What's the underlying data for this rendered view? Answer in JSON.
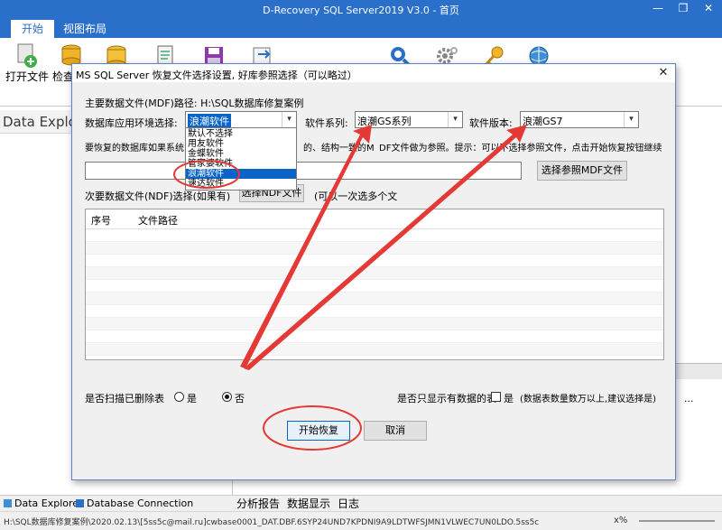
{
  "window": {
    "title": "D-Recovery SQL Server2019 V3.0 - 首页",
    "minimize": "—",
    "maximize": "❐",
    "close": "✕"
  },
  "ribbon": {
    "tabs": [
      {
        "label": "开始"
      },
      {
        "label": "视图布局"
      }
    ],
    "buttons": [
      {
        "label": "打开文件",
        "icon": "add-file-icon"
      },
      {
        "label": "检查",
        "icon": "database-check-icon"
      }
    ]
  },
  "left_panel": {
    "title": "Data Explorer"
  },
  "bottom_tabs": [
    {
      "label": "Data Explorer"
    },
    {
      "label": "Database Connection"
    }
  ],
  "right_tabs": [
    {
      "label": "分析报告"
    },
    {
      "label": "数据显示"
    },
    {
      "label": "日志"
    }
  ],
  "right_panel": {
    "ellipsis": "..."
  },
  "status": {
    "text": "H:\\SQL数据库修复案例\\2020.02.13\\[5ss5c@mail.ru]cwbase0001_DAT.DBF.6SYP24UND7KPDNI9A9LDTWFSJMN1VLWEC7UN0LDO.5ss5c",
    "zoom": "x%"
  },
  "dialog": {
    "title": "MS SQL Server 恢复文件选择设置, 好库参照选择（可以略过）",
    "close": "✕",
    "mdf_path_label": "主要数据文件(MDF)路径: H:\\SQL数据库修复案例",
    "env_label": "数据库应用环境选择:",
    "env_value": "浪潮软件",
    "env_options": [
      "默认不选择",
      "用友软件",
      "金蝶软件",
      "管家婆软件",
      "浪潮软件",
      "速达软件"
    ],
    "env_selected_index": 4,
    "series_label": "软件系列:",
    "series_value": "浪潮GS系列",
    "version_label": "软件版本:",
    "version_value": "浪潮GS7",
    "ref_hint": "要恢复的数据库如果系统...的、结构一致的MDF文件做为参照。提示：可以不选择参照文件，点击开始恢复按钮继续",
    "ref_hint_left": "要恢复的数据库如果系统",
    "ref_hint_right": "的、结构一致的M",
    "ref_hint_right2": "DF文件做为参照。提示：可以不选择参照文件，点击开始恢复按钮继续",
    "ref_path_value": "",
    "ref_button": "选择参照MDF文件",
    "ndf_label": "次要数据文件(NDF)选择(如果有)",
    "ndf_button": "选择NDF文件",
    "ndf_hint": "(可以一次选多个文",
    "table_headers": [
      "序号",
      "文件路径"
    ],
    "scan_deleted_label": "是否扫描已删除表",
    "yes": "是",
    "no": "否",
    "scan_deleted_value": "否",
    "only_data_label": "是否只显示有数据的表",
    "only_data_yes": "是",
    "only_data_hint": "(数据表数量数万以上,建议选择是)",
    "only_data_checked": false,
    "start_button": "开始恢复",
    "cancel_button": "取消"
  },
  "colors": {
    "titlebar": "#2a6fc9",
    "selection": "#0a64c8",
    "annotation_red": "#e53935"
  }
}
